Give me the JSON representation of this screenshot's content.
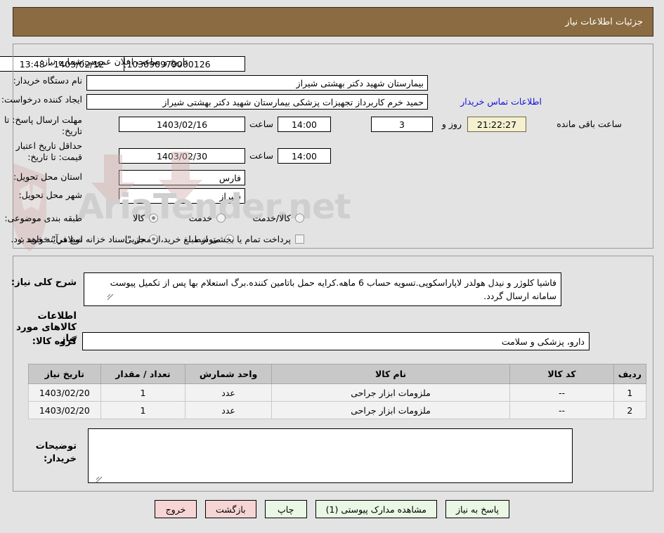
{
  "window": {
    "title": "جزئیات اطلاعات نیاز"
  },
  "watermark": {
    "text": "AriaTender.net"
  },
  "form": {
    "announce_date_label": "تاریخ و ساعت اعلان عمومی:",
    "announce_date_value": "1403/02/12 - 13:48",
    "need_number_label": "شماره نیاز:",
    "need_number_value": "1103090979000126",
    "buyer_org_label": "نام دستگاه خریدار:",
    "buyer_org_value": "بیمارستان شهید دکتر بهشتی شیراز",
    "creator_label": "ایجاد کننده درخواست:",
    "creator_value": "حمید خرم کاربرداز تجهیزات پزشکی بیمارستان شهید دکتر بهشتی شیراز",
    "contact_link": "اطلاعات تماس خریدار",
    "deadline_label": "مهلت ارسال پاسخ: تا تاریخ:",
    "deadline_date": "1403/02/16",
    "deadline_hour_label": "ساعت",
    "deadline_hour": "14:00",
    "days_value": "3",
    "days_label": "روز و",
    "countdown": "21:22:27",
    "countdown_label": "ساعت باقی مانده",
    "price_validity_label": "حداقل تاریخ اعتبار قیمت: تا تاریخ:",
    "price_validity_date": "1403/02/30",
    "price_validity_hour_label": "ساعت",
    "price_validity_hour": "14:00",
    "province_label": "استان محل تحویل:",
    "province_value": "فارس",
    "city_label": "شهر محل تحویل:",
    "city_value": "شیراز",
    "category_label": "طبقه بندی موضوعی:",
    "category_options": [
      "کالا",
      "خدمت",
      "کالا/خدمت"
    ],
    "category_selected": "کالا",
    "process_label": "نوع فرآیند خرید :",
    "process_options": [
      "جزیی",
      "متوسط"
    ],
    "process_selected": "جزیی",
    "treasury_checkbox_text": "پرداخت تمام یا بخشی از مبلغ خرید،از محل \"اسناد خزانه اسلامی\" خواهد بود.",
    "treasury_checked": false
  },
  "description": {
    "label": "شرح کلی نیاز:",
    "value": "فاشیا کلوژر و نیدل هولدر لاپاراسکوپی.تسویه حساب 6 ماهه.کرایه حمل باتامین کننده.برگ استعلام بها پس از تکمیل پیوست سامانه ارسال گردد."
  },
  "goods_section": {
    "title": "اطلاعات کالاهای مورد نیاز",
    "group_label": "گروه کالا:",
    "group_value": "دارو، پزشکی و سلامت",
    "columns": [
      "ردیف",
      "کد کالا",
      "نام کالا",
      "واحد شمارش",
      "تعداد / مقدار",
      "تاریخ نیاز"
    ],
    "rows": [
      {
        "index": "1",
        "code": "--",
        "name": "ملزومات ابزار جراحی",
        "unit": "عدد",
        "qty": "1",
        "date": "1403/02/20"
      },
      {
        "index": "2",
        "code": "--",
        "name": "ملزومات ابزار جراحی",
        "unit": "عدد",
        "qty": "1",
        "date": "1403/02/20"
      }
    ]
  },
  "buyer_notes": {
    "label": "توضیحات خریدار:",
    "value": ""
  },
  "buttons": [
    {
      "label": "پاسخ به نیاز",
      "style": "green"
    },
    {
      "label": "مشاهده مدارک پیوستی (1)",
      "style": "green"
    },
    {
      "label": "چاپ",
      "style": "green"
    },
    {
      "label": "بازگشت",
      "style": "pink"
    },
    {
      "label": "خروج",
      "style": "pink"
    }
  ],
  "colors": {
    "header_bg": "#8b6b42",
    "page_bg": "#e3e3e3",
    "link": "#1111dd",
    "timer_bg": "#f4f0d0",
    "btn_green": "#eaf7e4",
    "btn_pink": "#f7d5d5",
    "table_header_bg": "#c8c8c8"
  }
}
